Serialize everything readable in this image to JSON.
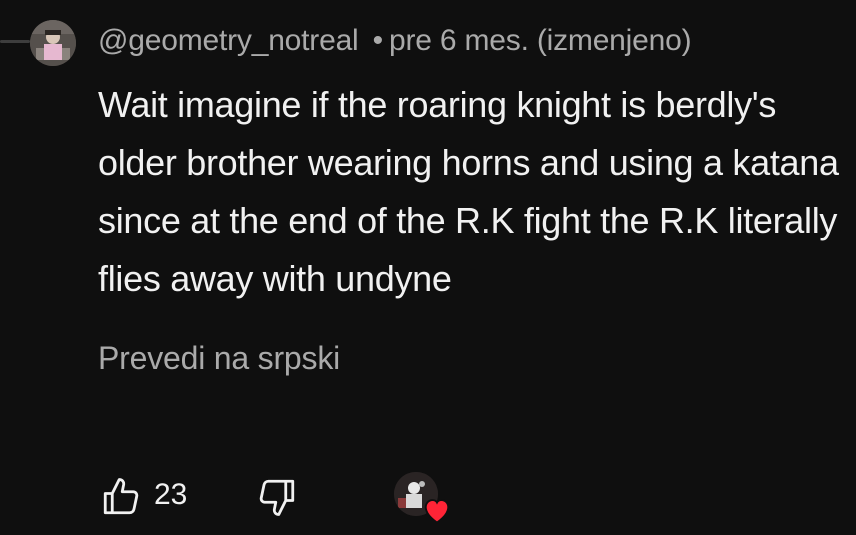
{
  "comment": {
    "author": "@geometry_notreal",
    "separator": "•",
    "timestamp": "pre 6 mes. (izmenjeno)",
    "text": "Wait imagine if the roaring knight is berdly's older brother wearing horns and using a katana since at the end of the R.K fight the R.K literally flies away with undyne",
    "translate_label": "Prevedi na srpski",
    "like_count": "23"
  },
  "icons": {
    "like": "thumbs-up-icon",
    "dislike": "thumbs-down-icon",
    "creator_heart": "heart-icon"
  },
  "colors": {
    "background": "#0f0f0f",
    "primary_text": "#f1f1f1",
    "secondary_text": "#aaaaaa",
    "heart": "#ff2436"
  }
}
